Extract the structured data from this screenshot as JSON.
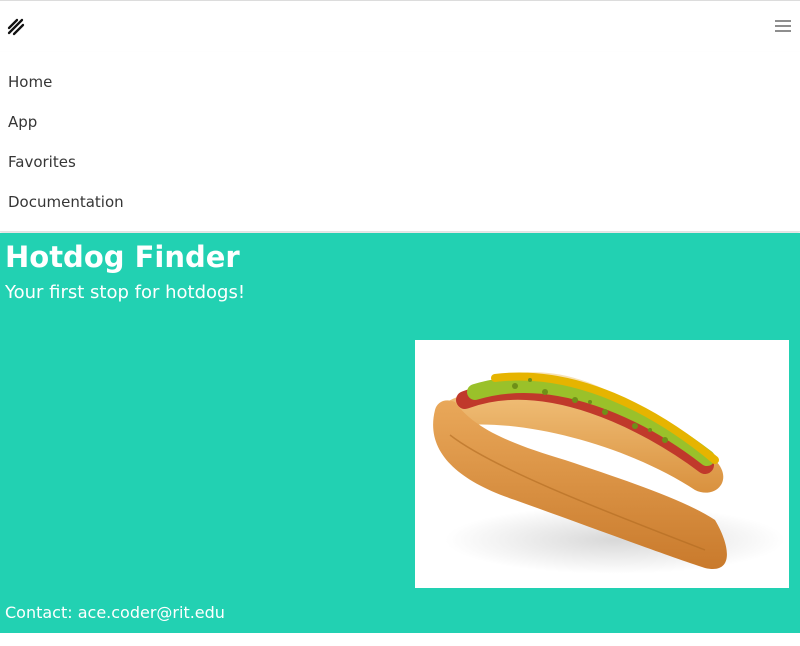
{
  "nav": {
    "logo_icon": "slashes-logo-icon",
    "menu_icon": "hamburger-menu-icon",
    "items": [
      {
        "label": "Home"
      },
      {
        "label": "App"
      },
      {
        "label": "Favorites"
      },
      {
        "label": "Documentation"
      }
    ]
  },
  "hero": {
    "title": "Hotdog Finder",
    "subtitle": "Your first stop for hotdogs!",
    "image_subject": "hotdog-photo",
    "contact": "Contact: ace.coder@rit.edu",
    "background_color": "#22d1b2"
  }
}
